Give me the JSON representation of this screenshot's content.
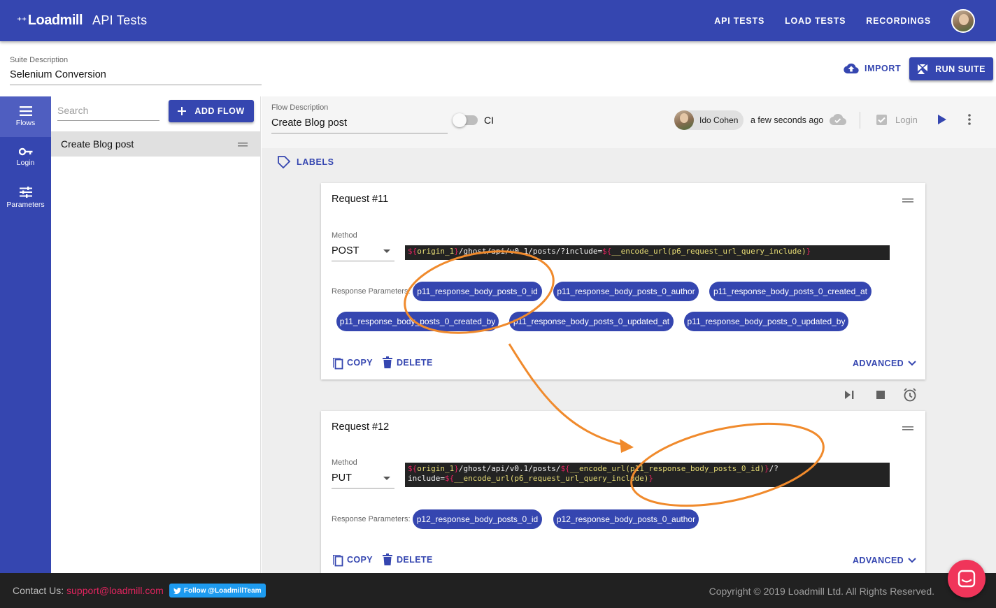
{
  "appbar": {
    "logo_text": "Loadmill",
    "title": "API Tests",
    "nav": [
      "API TESTS",
      "LOAD TESTS",
      "RECORDINGS"
    ]
  },
  "suite": {
    "description_label": "Suite Description",
    "description_value": "Selenium Conversion",
    "import_label": "IMPORT",
    "run_label": "RUN SUITE"
  },
  "rail": [
    {
      "label": "Flows",
      "icon": "list-icon"
    },
    {
      "label": "Login",
      "icon": "key-icon"
    },
    {
      "label": "Parameters",
      "icon": "tune-icon"
    }
  ],
  "flows_panel": {
    "search_placeholder": "Search",
    "add_flow_label": "ADD FLOW",
    "flows": [
      "Create Blog post"
    ]
  },
  "flow": {
    "description_label": "Flow Description",
    "description_value": "Create Blog post",
    "ci_label": "CI",
    "user_name": "Ido Cohen",
    "saved_time": "a few seconds ago",
    "login_label": "Login",
    "labels_label": "LABELS"
  },
  "requests": [
    {
      "title": "Request #11",
      "method_label": "Method",
      "method": "POST",
      "url_parts": [
        {
          "t": "${",
          "c": "d"
        },
        {
          "t": "origin_1",
          "c": "v"
        },
        {
          "t": "}",
          "c": "d"
        },
        {
          "t": "/ghost/api/v0.1/posts/?include=",
          "c": "p"
        },
        {
          "t": "${",
          "c": "d"
        },
        {
          "t": "__encode_url(p6_request_url_query_include)",
          "c": "v"
        },
        {
          "t": "}",
          "c": "d"
        }
      ],
      "response_label": "Response Parameters:",
      "params": [
        "p11_response_body_posts_0_id",
        "p11_response_body_posts_0_author",
        "p11_response_body_posts_0_created_at",
        "p11_response_body_posts_0_created_by",
        "p11_response_body_posts_0_updated_at",
        "p11_response_body_posts_0_updated_by"
      ],
      "copy_label": "COPY",
      "delete_label": "DELETE",
      "advanced_label": "ADVANCED"
    },
    {
      "title": "Request #12",
      "method_label": "Method",
      "method": "PUT",
      "url_parts": [
        {
          "t": "${",
          "c": "d"
        },
        {
          "t": "origin_1",
          "c": "v"
        },
        {
          "t": "}",
          "c": "d"
        },
        {
          "t": "/ghost/api/v0.1/posts/",
          "c": "p"
        },
        {
          "t": "${",
          "c": "d"
        },
        {
          "t": "__encode_url(p11_response_body_posts_0_id)",
          "c": "v"
        },
        {
          "t": "}",
          "c": "d"
        },
        {
          "t": "/?\ninclude=",
          "c": "p"
        },
        {
          "t": "${",
          "c": "d"
        },
        {
          "t": "__encode_url(p6_request_url_query_include)",
          "c": "v"
        },
        {
          "t": "}",
          "c": "d"
        }
      ],
      "response_label": "Response Parameters:",
      "params": [
        "p12_response_body_posts_0_id",
        "p12_response_body_posts_0_author"
      ],
      "copy_label": "COPY",
      "delete_label": "DELETE",
      "advanced_label": "ADVANCED"
    }
  ],
  "footer": {
    "contact_label": "Contact Us:",
    "contact_email": "support@loadmill.com",
    "twitter_label": "Follow @LoadmillTeam",
    "copyright": "Copyright © 2019 Loadmill Ltd. All Rights Reserved."
  },
  "colors": {
    "primary": "#3546b0",
    "annotation": "#f08a2c",
    "accent": "#f0355a"
  }
}
